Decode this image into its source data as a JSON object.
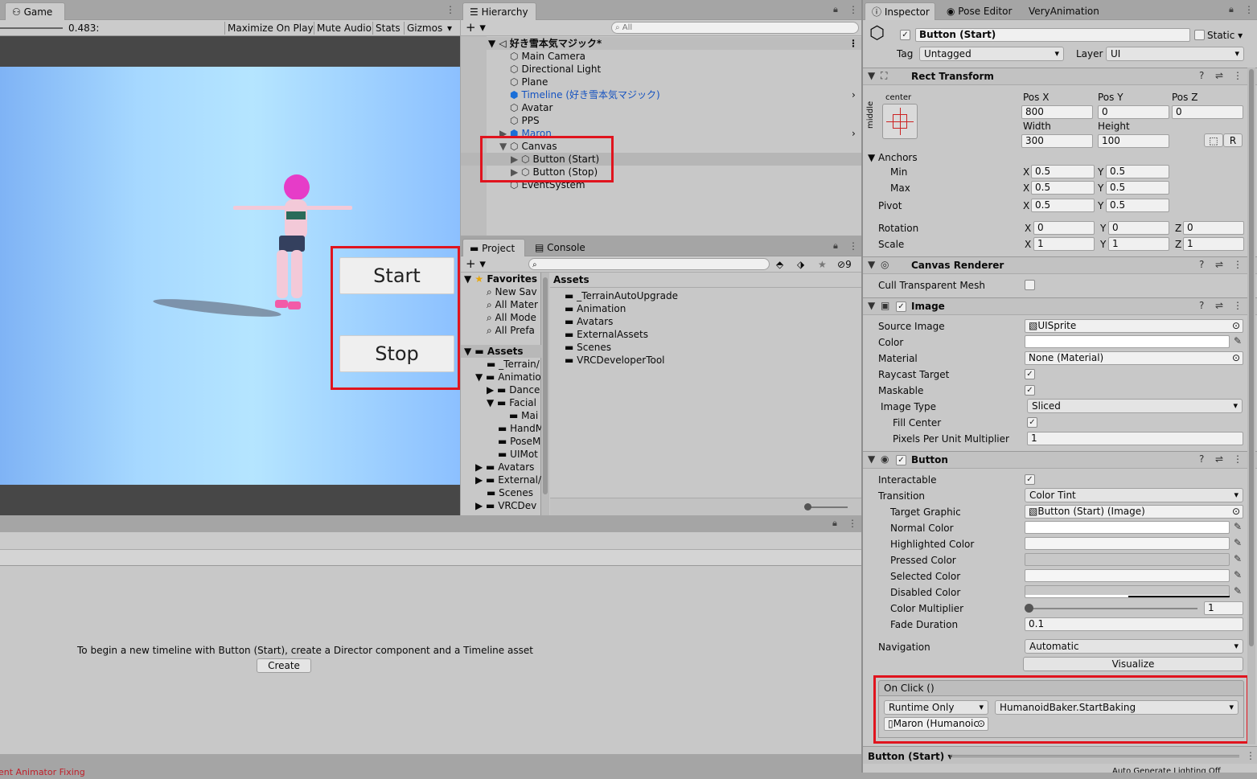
{
  "game": {
    "tab": "Game",
    "scale_value": "0.483:",
    "toolbar": [
      "Maximize On Play",
      "Mute Audio",
      "Stats",
      "Gizmos"
    ],
    "start_button": "Start",
    "stop_button": "Stop"
  },
  "hierarchy": {
    "tab": "Hierarchy",
    "search_placeholder": "All",
    "scene": "好き雪本気マジック*",
    "items": [
      "Main Camera",
      "Directional Light",
      "Plane",
      "Timeline (好き雪本気マジック)",
      "Avatar",
      "PPS",
      "Maron",
      "Canvas",
      "Button (Start)",
      "Button (Stop)",
      "EventSystem"
    ]
  },
  "project": {
    "tab_project": "Project",
    "tab_console": "Console",
    "hidden_count": "9",
    "favorites_label": "Favorites",
    "favorites": [
      "New Sav",
      "All Mater",
      "All Mode",
      "All Prefa"
    ],
    "assets_label": "Assets",
    "tree": [
      "_Terrain/",
      "Animatio",
      "Dance",
      "Facial",
      "Mai",
      "HandM",
      "PoseM",
      "UIMot",
      "Avatars",
      "External/",
      "Scenes",
      "VRCDev"
    ],
    "assets_header": "Assets",
    "assets": [
      "_TerrainAutoUpgrade",
      "Animation",
      "Avatars",
      "ExternalAssets",
      "Scenes",
      "VRCDeveloperTool"
    ]
  },
  "timeline": {
    "message": "To begin a new timeline with Button (Start), create a Director component and a Timeline asset",
    "create_button": "Create",
    "status_text": "ent Animator Fixing"
  },
  "inspector": {
    "tabs": [
      "Inspector",
      "Pose Editor",
      "VeryAnimation"
    ],
    "object_name": "Button (Start)",
    "static_label": "Static",
    "tag_label": "Tag",
    "tag_value": "Untagged",
    "layer_label": "Layer",
    "layer_value": "UI",
    "rect_transform": {
      "title": "Rect Transform",
      "anchor_h": "center",
      "anchor_v": "middle",
      "posx_label": "Pos X",
      "posx": "800",
      "posy_label": "Pos Y",
      "posy": "0",
      "posz_label": "Pos Z",
      "posz": "0",
      "width_label": "Width",
      "width": "300",
      "height_label": "Height",
      "height": "100",
      "r_button": "R",
      "anchors_label": "Anchors",
      "min_label": "Min",
      "min_x": "0.5",
      "min_y": "0.5",
      "max_label": "Max",
      "max_x": "0.5",
      "max_y": "0.5",
      "pivot_label": "Pivot",
      "pivot_x": "0.5",
      "pivot_y": "0.5",
      "rotation_label": "Rotation",
      "rot_x": "0",
      "rot_y": "0",
      "rot_z": "0",
      "scale_label": "Scale",
      "scale_x": "1",
      "scale_y": "1",
      "scale_z": "1",
      "axis_x": "X",
      "axis_y": "Y",
      "axis_z": "Z"
    },
    "canvas_renderer": {
      "title": "Canvas Renderer",
      "cull_label": "Cull Transparent Mesh"
    },
    "image": {
      "title": "Image",
      "source_label": "Source Image",
      "source": "UISprite",
      "color_label": "Color",
      "material_label": "Material",
      "material": "None (Material)",
      "raycast_label": "Raycast Target",
      "maskable_label": "Maskable",
      "type_label": "Image Type",
      "type": "Sliced",
      "fill_label": "Fill Center",
      "ppu_label": "Pixels Per Unit Multiplier",
      "ppu": "1"
    },
    "button": {
      "title": "Button",
      "interactable_label": "Interactable",
      "transition_label": "Transition",
      "transition": "Color Tint",
      "target_label": "Target Graphic",
      "target": "Button (Start) (Image)",
      "normal_label": "Normal Color",
      "highlighted_label": "Highlighted Color",
      "pressed_label": "Pressed Color",
      "selected_label": "Selected Color",
      "disabled_label": "Disabled Color",
      "multiplier_label": "Color Multiplier",
      "multiplier": "1",
      "fade_label": "Fade Duration",
      "fade": "0.1",
      "navigation_label": "Navigation",
      "navigation": "Automatic",
      "visualize": "Visualize",
      "onclick_label": "On Click ()",
      "runtime": "Runtime Only",
      "function": "HumanoidBaker.StartBaking",
      "target_obj": "Maron (Humanoic"
    },
    "footer_object": "Button (Start)",
    "lighting_status": "Auto Generate Lighting Off"
  }
}
